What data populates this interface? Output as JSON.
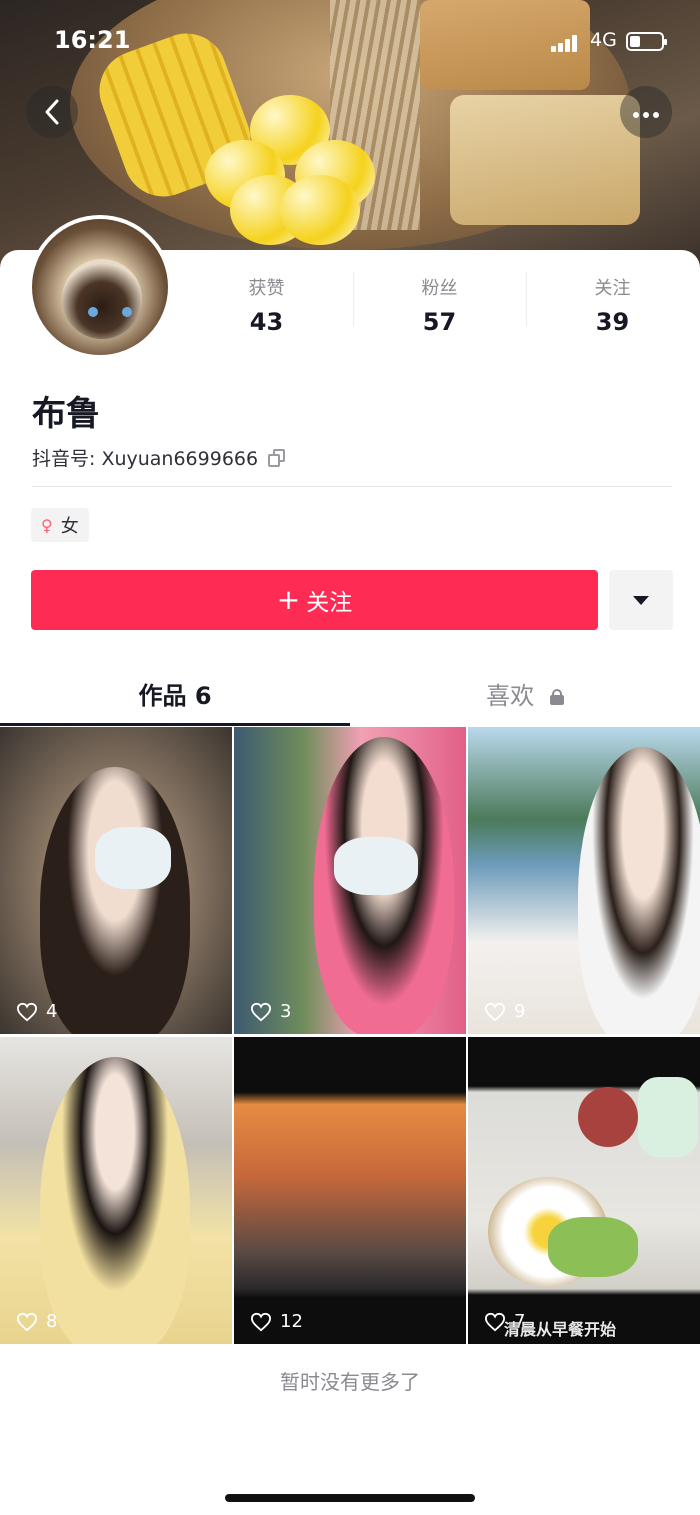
{
  "status_bar": {
    "time": "16:21",
    "network": "4G",
    "battery_icon": "battery-icon",
    "signal_icon": "signal-icon"
  },
  "nav": {
    "back_icon": "chevron-left-icon",
    "more_icon": "more-dots-icon"
  },
  "profile": {
    "nickname": "布鲁",
    "douyin_id": "抖音号: Xuyuan6699666",
    "gender": "女",
    "gender_icon": "female-icon"
  },
  "stats": [
    {
      "label": "获赞",
      "value": "43"
    },
    {
      "label": "粉丝",
      "value": "57"
    },
    {
      "label": "关注",
      "value": "39"
    }
  ],
  "actions": {
    "follow_label": "关注",
    "follow_plus": "+",
    "accent_color": "#fe2c55"
  },
  "tabs": [
    {
      "label": "作品 6",
      "active": true
    },
    {
      "label": "喜欢",
      "active": false,
      "icon": "lock-icon"
    }
  ],
  "videos": [
    {
      "likes": "4"
    },
    {
      "likes": "3"
    },
    {
      "likes": "9"
    },
    {
      "likes": "8"
    },
    {
      "likes": "12"
    },
    {
      "likes": "7",
      "caption": "清晨从早餐开始"
    }
  ],
  "footer": {
    "end_note": "暂时没有更多了"
  }
}
